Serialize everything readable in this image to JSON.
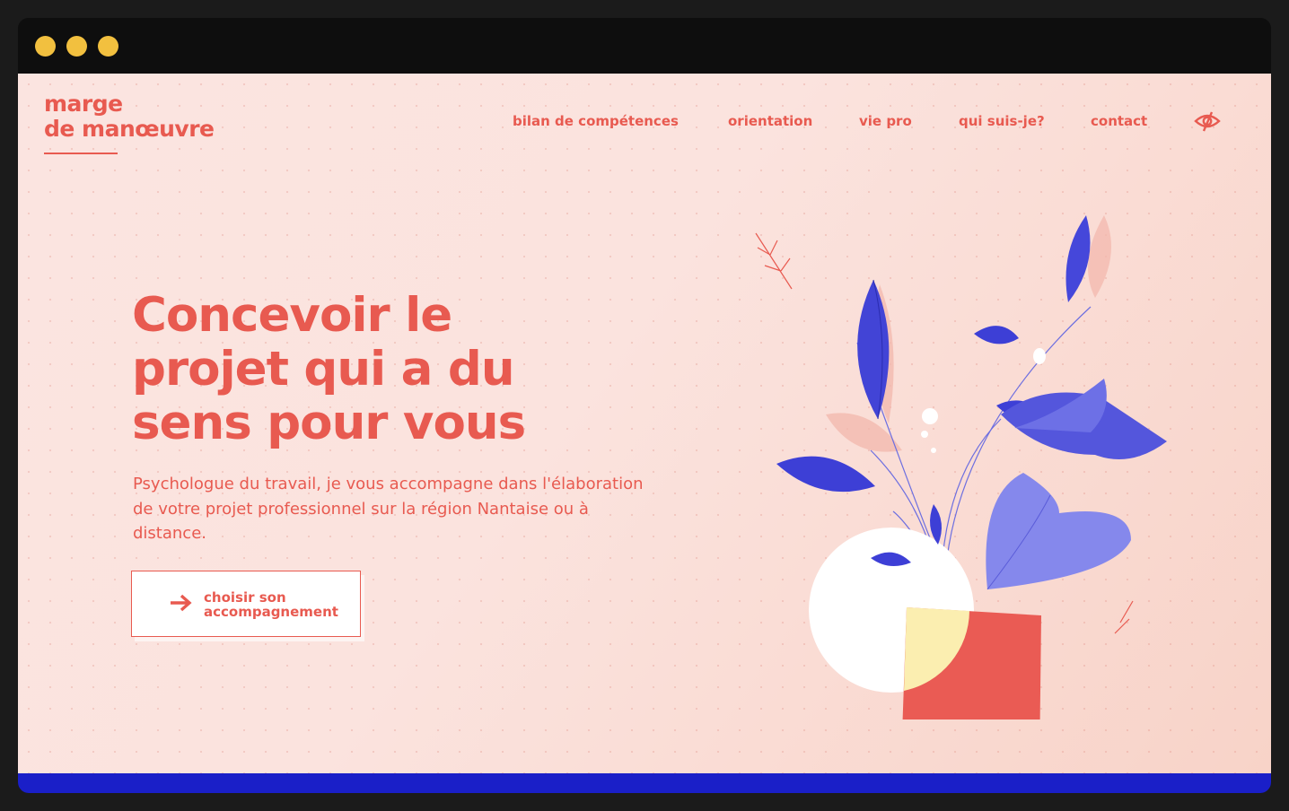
{
  "window": {
    "controls": [
      "close",
      "minimize",
      "maximize"
    ]
  },
  "logo": {
    "line1": "marge",
    "line2": "de manœuvre"
  },
  "nav": {
    "items": [
      {
        "label": "bilan de compétences"
      },
      {
        "label": "orientation"
      },
      {
        "label": "vie pro"
      },
      {
        "label": "qui suis-je?"
      },
      {
        "label": "contact"
      }
    ],
    "accessibility_icon": "eye-icon"
  },
  "hero": {
    "headline_line1": "Concevoir le",
    "headline_line2": "projet qui a du",
    "headline_line3": "sens pour vous",
    "subtitle": "Psychologue du travail, je vous accompagne dans l'élaboration de votre projet professionnel sur la région Nantaise ou à distance.",
    "cta_line1": "choisir son",
    "cta_line2": "accompagnement",
    "cta_icon": "arrow-right-icon"
  },
  "colors": {
    "accent": "#e85a50",
    "background": "#fbe3de",
    "leaf_blue": "#3d3fd6",
    "leaf_light": "#7b7ee8",
    "pot_red": "#ea5b54",
    "pot_yellow": "#fbeeb0",
    "bottom_bar": "#1a1fc8",
    "window_dots": "#f2c03f"
  }
}
